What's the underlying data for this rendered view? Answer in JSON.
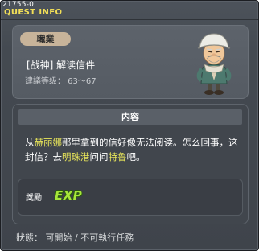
{
  "window": {
    "id": "21755-0",
    "title": "QUEST INFO"
  },
  "job_panel": {
    "badge": "職業",
    "quest_name": "[战神] 解读信件",
    "level_requirement": "建議等级： 63～67",
    "npc_portrait": "npc-elder-icon"
  },
  "content": {
    "header": "内容",
    "body": [
      {
        "text": "从",
        "highlight": false
      },
      {
        "text": "赫丽娜",
        "highlight": true
      },
      {
        "text": "那里拿到的信好像无法阅读。怎么回事，这封信？去",
        "highlight": false
      },
      {
        "text": "明珠港",
        "highlight": true
      },
      {
        "text": "问问",
        "highlight": false
      },
      {
        "text": "特鲁",
        "highlight": true
      },
      {
        "text": "吧。",
        "highlight": false
      }
    ],
    "reward_label": "獎勵",
    "reward_icon_text": "EXP"
  },
  "status": {
    "text": "狀態： 可開始 / 不可執行任務"
  },
  "colors": {
    "title": "#f2df57",
    "highlight": "#e9e65a",
    "exp": "#a7e63a"
  }
}
